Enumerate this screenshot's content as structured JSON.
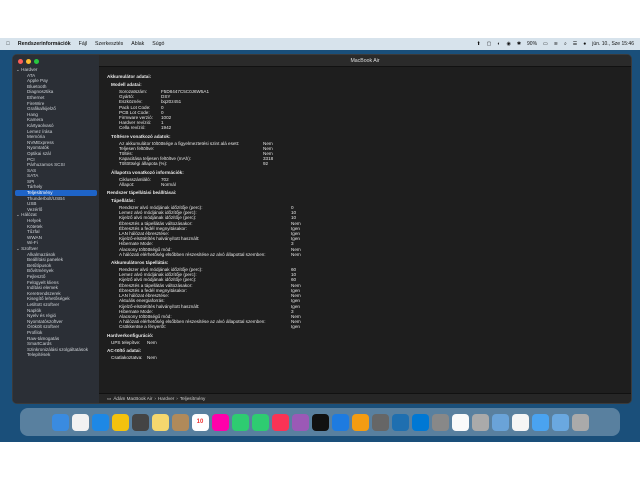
{
  "menubar": {
    "app": "Rendszerinformációk",
    "items": [
      "Fájl",
      "Szerkesztés",
      "Ablak",
      "Súgó"
    ],
    "battery": "90%",
    "datetime": "jún. 10., Sze 15:46"
  },
  "window": {
    "title": "MacBook Air"
  },
  "sidebar": {
    "groups": [
      {
        "label": "Hardver",
        "items": [
          "ATA",
          "Apple Pay",
          "Bluetooth",
          "Diagnosztika",
          "Ethernet",
          "FireWire",
          "Grafika/kijelző",
          "Hang",
          "Kamera",
          "Kártyaolvasó",
          "Lemez írása",
          "Memória",
          "NVMExpress",
          "Nyomtatók",
          "Optikai szál",
          "PCI",
          "Párhuzamos SCSI",
          "SAS",
          "SATA",
          "SPI",
          "Tárhely",
          "Teljesítmény",
          "Thunderbolt/USB4",
          "USB",
          "Vezérlő"
        ]
      },
      {
        "label": "Hálózat",
        "items": [
          "Helyek",
          "Kötetek",
          "Tűzfal",
          "WWAN",
          "Wi-Fi"
        ]
      },
      {
        "label": "Szoftver",
        "items": [
          "Alkalmazások",
          "Beállítási panelek",
          "Betűtípusok",
          "Bővítmények",
          "Fejlesztő",
          "Felügyelt kliens",
          "Indítási elemek",
          "Keretrendszerek",
          "Kisegítő lehetőségek",
          "Letiltott szoftver",
          "Naplók",
          "Nyelv és régió",
          "Nyomtatószoftver",
          "Örökölt szoftver",
          "Profilok",
          "Raw-támogatás",
          "SmartCards",
          "Szinkronizálási szolgáltatások",
          "Telepítések"
        ]
      }
    ],
    "selected": "Teljesítmény"
  },
  "content": {
    "battery_title": "Akkumulátor adatai:",
    "model_title": "Modell adatai:",
    "model_rows": [
      [
        "Sorozatszám:",
        "F5D8447C5C0J6W5A1"
      ],
      [
        "Gyártó:",
        "DSY"
      ],
      [
        "Eszköznév:",
        "bq20z451"
      ],
      [
        "Pack Lot Code:",
        "0"
      ],
      [
        "PCB Lot Code:",
        "0"
      ],
      [
        "Firmware verzió:",
        "1002"
      ],
      [
        "Hardver revízió:",
        "1"
      ],
      [
        "Cella revízió:",
        "1942"
      ]
    ],
    "charge_title": "Töltésre vonatkozó adatok:",
    "charge_rows": [
      [
        "Az akkumulátor töltöttsége a figyelmeztetési szint alá esett:",
        "Nem"
      ],
      [
        "Teljesen feltöltve:",
        "Nem"
      ],
      [
        "Töltés:",
        "Nem"
      ],
      [
        "Kapacitása teljesen feltöltve (mAh):",
        "3318"
      ],
      [
        "Töltöttségi állapota (%):",
        "92"
      ]
    ],
    "health_title": "Állapotra vonatkozó információk:",
    "health_rows": [
      [
        "Ciklusszámláló:",
        "702"
      ],
      [
        "Állapot:",
        "Normál"
      ]
    ],
    "power_title": "Rendszer tápellátási beállításai:",
    "ac_title": "Tápellátás:",
    "ac_rows": [
      [
        "Rendszer alvó módjának időzítője (perc):",
        "0"
      ],
      [
        "Lemez alvó módjának időzítője (perc):",
        "10"
      ],
      [
        "Kijelző alvó módjának időzítője (perc):",
        "10"
      ],
      [
        "Ébresztés a tápellátás változásakor:",
        "Nem"
      ],
      [
        "Ébresztés a fedél megnyitásakor:",
        "Igen"
      ],
      [
        "LAN hálózat ébresztése:",
        "Igen"
      ],
      [
        "Kijelző-elsötétítés halványított használt:",
        "Igen"
      ],
      [
        "Hibernate Mode:",
        "3"
      ],
      [
        "Alacsony töltöttségű mód:",
        "Nem"
      ],
      [
        "A hálózati elérhetőség elsőbben részesítése az alvó állapottal szemben:",
        "Nem"
      ]
    ],
    "batt_title": "Akkumulátoros tápellátás:",
    "batt_rows": [
      [
        "Rendszer alvó módjának időzítője (perc):",
        "60"
      ],
      [
        "Lemez alvó módjának időzítője (perc):",
        "10"
      ],
      [
        "Kijelző alvó módjának időzítője (perc):",
        "60"
      ],
      [
        "Ébresztés a tápellátás változásakor:",
        "Nem"
      ],
      [
        "Ébresztés a fedél megnyitásakor:",
        "Igen"
      ],
      [
        "LAN hálózat ébresztése:",
        "Nem"
      ],
      [
        "Aktuális energiaforrás:",
        "Igen"
      ],
      [
        "Kijelző-elsötétítés halványított használt:",
        "Igen"
      ],
      [
        "Hibernate Mode:",
        "3"
      ],
      [
        "Alacsony töltöttségű mód:",
        "Nem"
      ],
      [
        "A hálózati elérhetőség elsőbben részesítése az alvó állapottal szemben:",
        "Nem"
      ],
      [
        "Csökkentse a fényerőt:",
        "Igen"
      ]
    ],
    "hw_title": "Hardverkonfiguráció:",
    "ups_row": [
      "UPS telepítve:",
      "Nem"
    ],
    "ac_charger_title": "AC-töltő adatai:",
    "charger_row": [
      "Csatlakoztatva:",
      "Nem"
    ]
  },
  "pathbar": {
    "parts": [
      "Ádám MacBook Air",
      "Hardver",
      "Teljesítmény"
    ]
  },
  "dock": {
    "items": [
      "finder",
      "launchpad",
      "safari",
      "chrome",
      "calculator",
      "notes",
      "contacts",
      "calendar",
      "photos",
      "facetime",
      "numbers",
      "music",
      "podcasts",
      "tv",
      "appstore",
      "vlc",
      "unknown",
      "qbittorrent",
      "skype",
      "system-preferences",
      "clock",
      "disk-utility",
      "preview",
      "textedit",
      "downloads",
      "folder",
      "trash"
    ],
    "calendar_day": "10"
  }
}
